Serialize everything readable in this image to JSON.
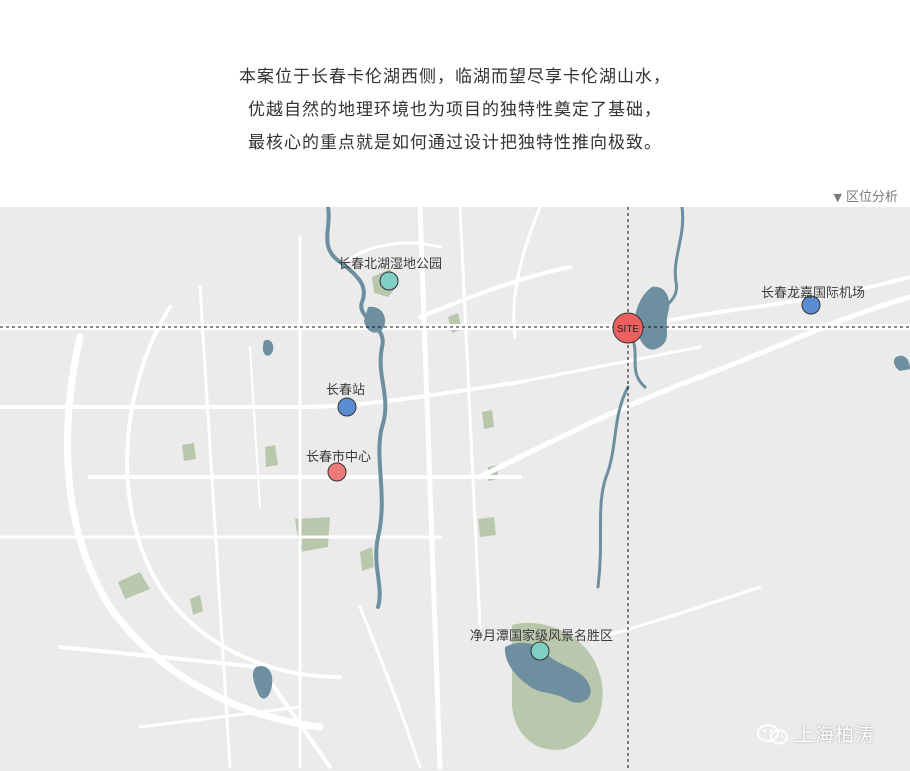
{
  "intro": {
    "lines": [
      "本案位于长春卡伦湖西侧，临湖而望尽享卡伦湖山水，",
      "优越自然的地理环境也为项目的独特性奠定了基础，",
      "最核心的重点就是如何通过设计把独特性推向极致。"
    ]
  },
  "section_tag": {
    "label": "区位分析",
    "icon": "triangle-down-icon"
  },
  "map": {
    "site_label": "SITE",
    "places": [
      {
        "name": "长春北湖湿地公园",
        "kind": "park"
      },
      {
        "name": "长春龙嘉国际机场",
        "kind": "airport"
      },
      {
        "name": "长春站",
        "kind": "station"
      },
      {
        "name": "长春市中心",
        "kind": "center"
      },
      {
        "name": "净月潭国家级风景名胜区",
        "kind": "scenic-area"
      }
    ],
    "colors": {
      "background": "#ebebeb",
      "road": "#ffffff",
      "water": "#6e8fa0",
      "green": "#b9c8ad",
      "marker_teal": "#7fcfc4",
      "marker_blue": "#5b8bd0",
      "marker_red": "#ef7a7a",
      "site_red": "#ee5f5f"
    }
  },
  "watermark": {
    "text": "上海柏涛",
    "icon": "wechat-icon"
  }
}
